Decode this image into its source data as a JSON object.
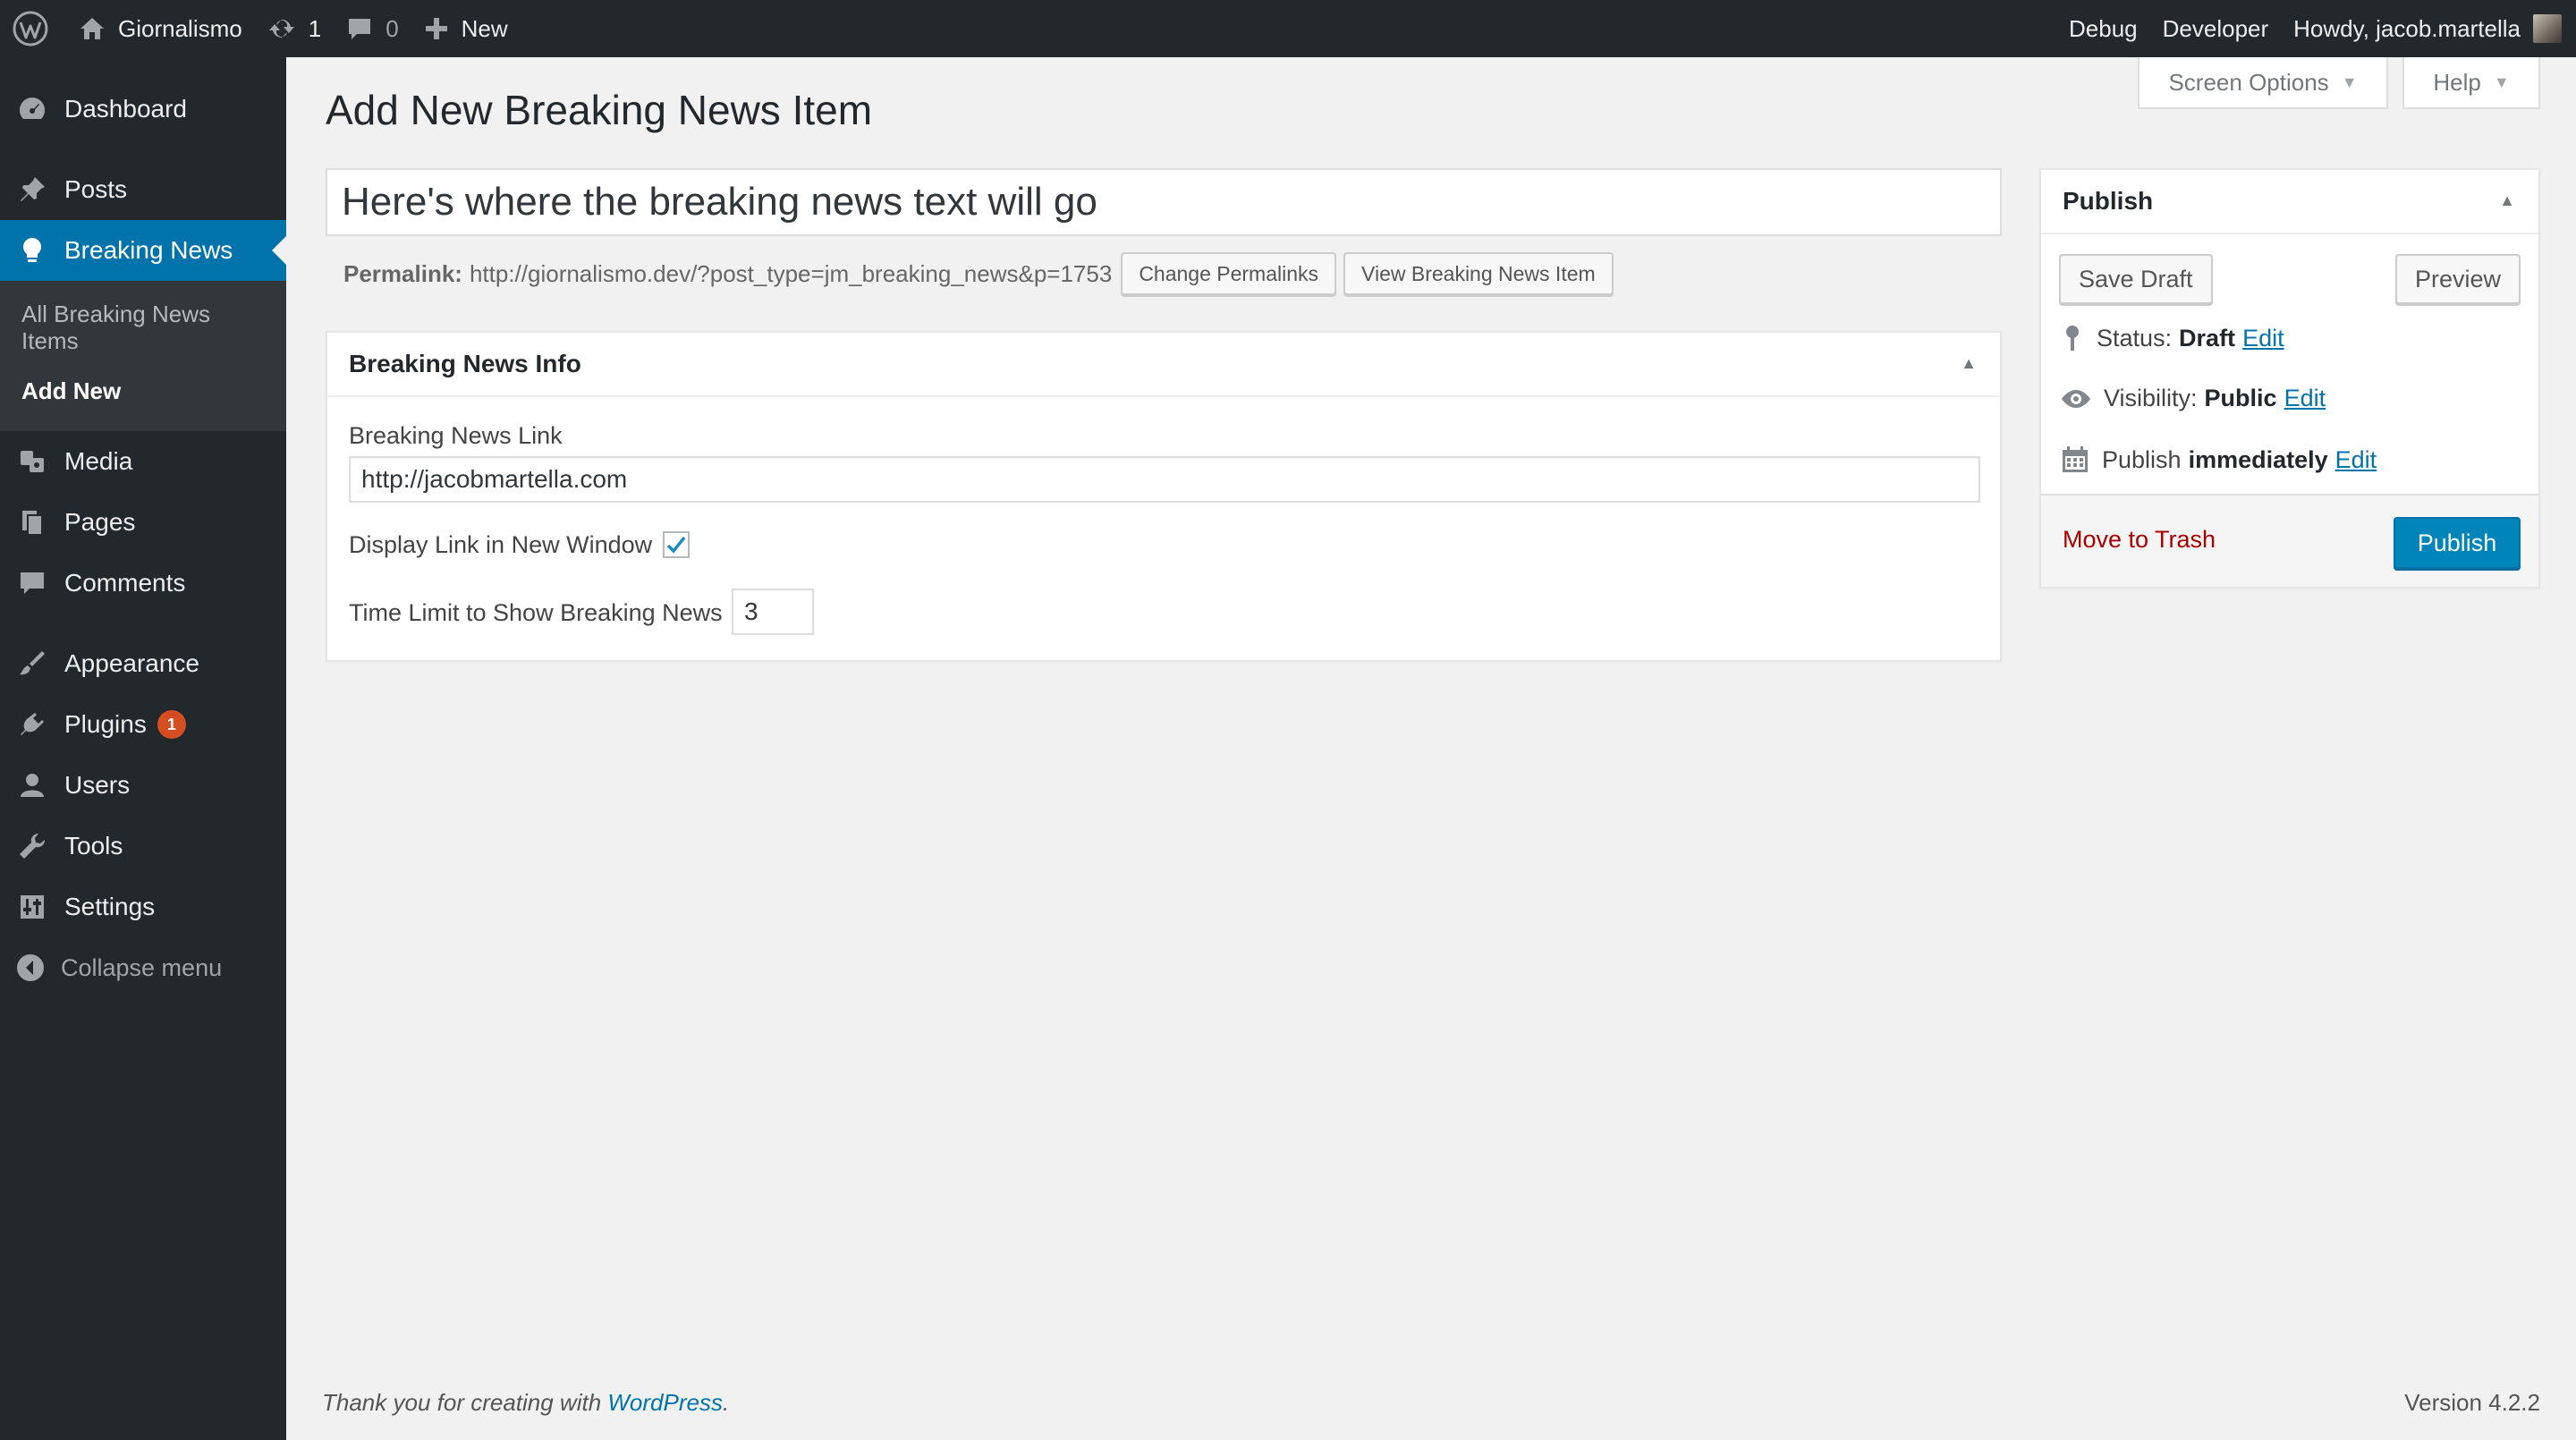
{
  "adminbar": {
    "site_name": "Giornalismo",
    "updates_count": "1",
    "comments_count": "0",
    "new_label": "New",
    "debug_label": "Debug",
    "developer_label": "Developer",
    "howdy_label": "Howdy, jacob.martella"
  },
  "sidebar": {
    "items": [
      {
        "label": "Dashboard",
        "icon": "dashboard-icon"
      },
      {
        "label": "Posts",
        "icon": "pin-icon"
      },
      {
        "label": "Breaking News",
        "icon": "lightbulb-icon"
      },
      {
        "label": "Media",
        "icon": "media-icon"
      },
      {
        "label": "Pages",
        "icon": "pages-icon"
      },
      {
        "label": "Comments",
        "icon": "comment-icon"
      },
      {
        "label": "Appearance",
        "icon": "brush-icon"
      },
      {
        "label": "Plugins",
        "icon": "plugin-icon"
      },
      {
        "label": "Users",
        "icon": "user-icon"
      },
      {
        "label": "Tools",
        "icon": "wrench-icon"
      },
      {
        "label": "Settings",
        "icon": "settings-icon"
      }
    ],
    "submenu": {
      "all_items": "All Breaking News Items",
      "add_new": "Add New"
    },
    "plugins_badge": "1",
    "collapse_label": "Collapse menu"
  },
  "screen_meta": {
    "screen_options": "Screen Options",
    "help": "Help"
  },
  "page": {
    "title": "Add New Breaking News Item",
    "post_title": "Here's where the breaking news text will go"
  },
  "permalink": {
    "label": "Permalink:",
    "url": "http://giornalismo.dev/?post_type=jm_breaking_news&p=1753",
    "change_button": "Change Permalinks",
    "view_button": "View Breaking News Item"
  },
  "info_box": {
    "title": "Breaking News Info",
    "link_label": "Breaking News Link",
    "link_value": "http://jacobmartella.com",
    "new_window_label": "Display Link in New Window",
    "new_window_checked": true,
    "time_limit_label": "Time Limit to Show Breaking News",
    "time_limit_value": "3"
  },
  "publish_box": {
    "title": "Publish",
    "save_draft": "Save Draft",
    "preview": "Preview",
    "status_label": "Status:",
    "status_value": "Draft",
    "visibility_label": "Visibility:",
    "visibility_value": "Public",
    "publish_label": "Publish",
    "publish_value": "immediately",
    "edit_label": "Edit",
    "trash_label": "Move to Trash",
    "publish_button": "Publish"
  },
  "footer": {
    "thanks_prefix": "Thank you for creating with",
    "thanks_link": "WordPress",
    "thanks_suffix": ".",
    "version": "Version 4.2.2"
  },
  "colors": {
    "adminbar_bg": "#23282d",
    "menu_current": "#0073aa",
    "publish_button": "#0085ba",
    "trash_link": "#aa0000",
    "link": "#0073aa",
    "badge": "#d54e21"
  }
}
